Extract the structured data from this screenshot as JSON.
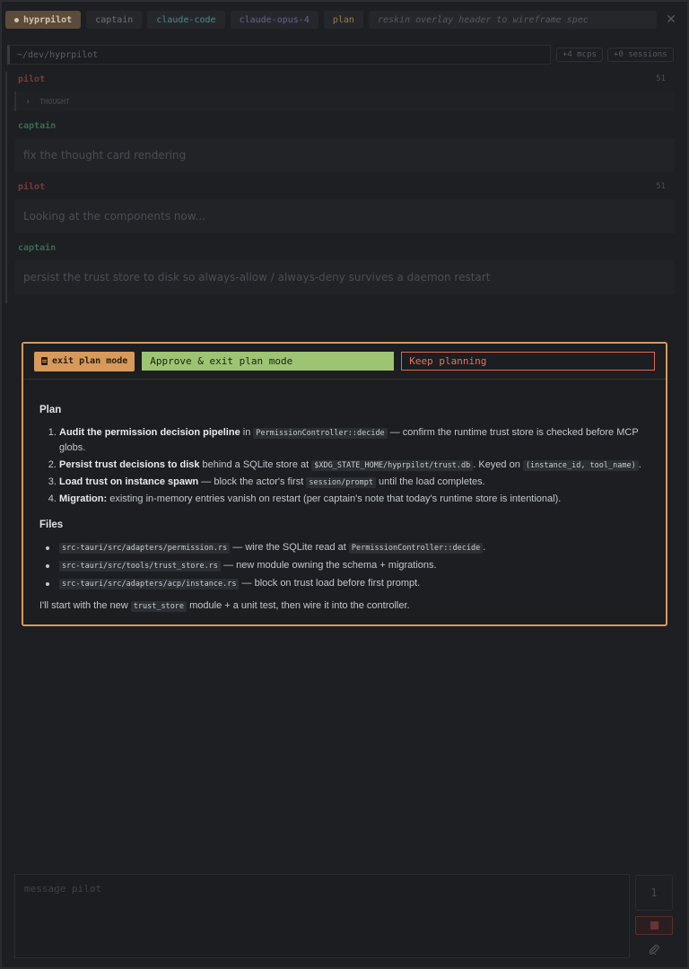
{
  "header": {
    "brand": "hyprpilot",
    "actor": "captain",
    "adapter": "claude-code",
    "model": "claude-opus-4",
    "mode": "plan",
    "title": "reskin overlay header to wireframe spec",
    "close_icon": "close-icon"
  },
  "pathbar": {
    "path": "~/dev/hyprpilot",
    "mcps": "+4 mcps",
    "sessions": "+0 sessions"
  },
  "transcript": {
    "messages": [
      {
        "who": "pilot",
        "stamp": "51",
        "kind": "thought",
        "text": "THOUGHT"
      },
      {
        "who": "captain",
        "stamp": "",
        "kind": "text",
        "text": "fix the thought card rendering"
      },
      {
        "who": "pilot",
        "stamp": "51",
        "kind": "text",
        "text": "Looking at the components now..."
      },
      {
        "who": "captain",
        "stamp": "",
        "kind": "text",
        "text": "persist the trust store to disk so always-allow / always-deny survives a daemon restart"
      }
    ]
  },
  "modal": {
    "badge": "exit plan mode",
    "approve_label": "Approve & exit plan mode",
    "keep_label": "Keep planning",
    "plan_heading": "Plan",
    "steps": [
      {
        "bold": "Audit the permission decision pipeline",
        "pre": " in ",
        "code": "PermissionController::decide",
        "post": " — confirm the runtime trust store is checked before MCP globs."
      },
      {
        "bold": "Persist trust decisions to disk",
        "pre": " behind a SQLite store at ",
        "code": "$XDG_STATE_HOME/hyprpilot/trust.db",
        "mid": ". Keyed on ",
        "code2": "(instance_id, tool_name)",
        "post": "."
      },
      {
        "bold": "Load trust on instance spawn",
        "pre": " — block the actor's first ",
        "code": "session/prompt",
        "post": " until the load completes."
      },
      {
        "bold": "Migration:",
        "pre": " existing in-memory entries vanish on restart (per captain's note that today's runtime store is intentional).",
        "code": "",
        "post": ""
      }
    ],
    "files_heading": "Files",
    "files": [
      {
        "code": "src-tauri/src/adapters/permission.rs",
        "pre": " — wire the SQLite read at ",
        "code2": "PermissionController::decide",
        "post": "."
      },
      {
        "code": "src-tauri/src/tools/trust_store.rs",
        "pre": " — new module owning the schema + migrations.",
        "code2": "",
        "post": ""
      },
      {
        "code": "src-tauri/src/adapters/acp/instance.rs",
        "pre": " — block on trust load before first prompt.",
        "code2": "",
        "post": ""
      }
    ],
    "closing_pre": "I'll start with the new ",
    "closing_code": "trust_store",
    "closing_post": " module + a unit test, then wire it into the controller."
  },
  "composer": {
    "placeholder": "message pilot",
    "queue_count": "1",
    "stop_icon": "stop-icon",
    "attach_icon": "paperclip-icon"
  },
  "colors": {
    "accent": "#d69b5a",
    "approve": "#9dc473",
    "keep": "#e0694f"
  }
}
